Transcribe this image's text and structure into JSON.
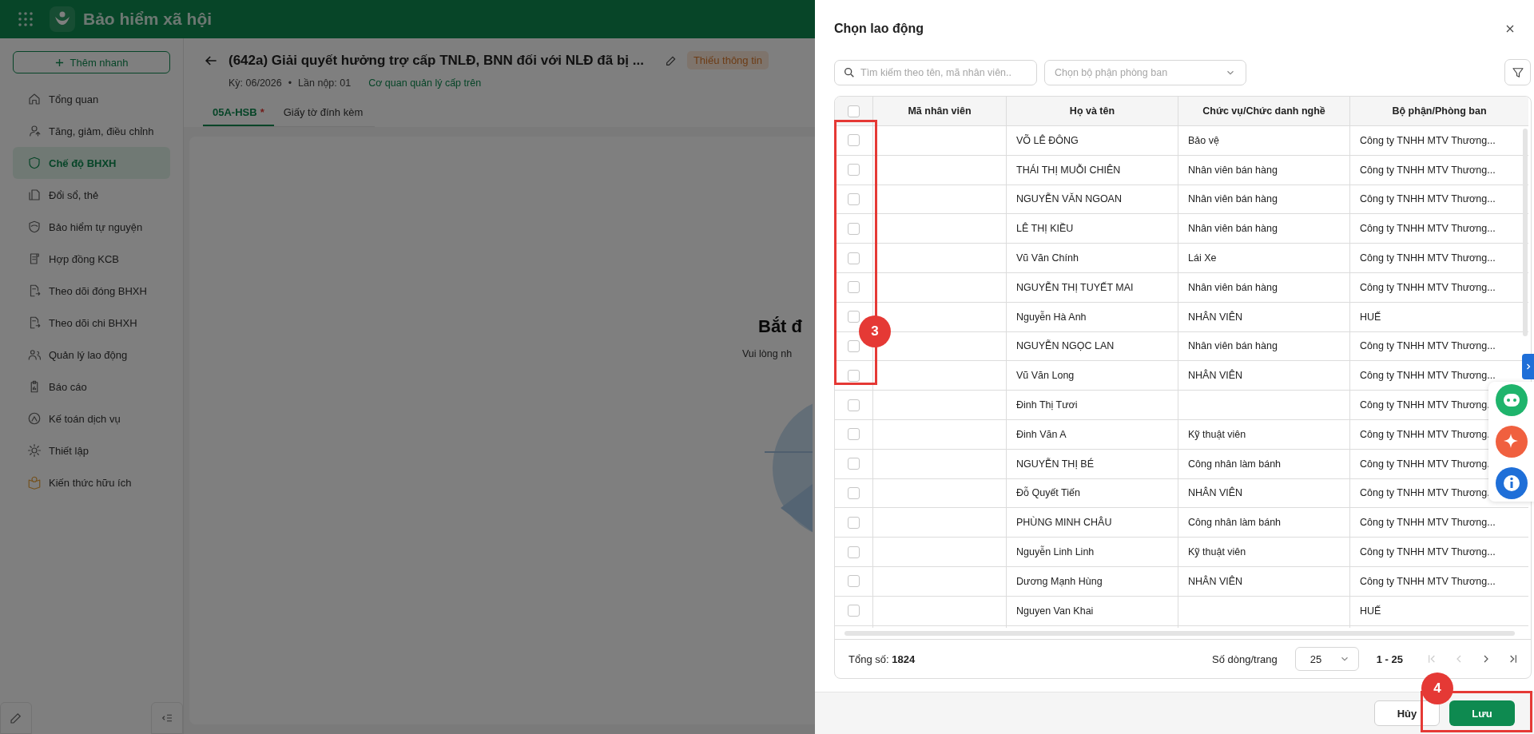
{
  "app_header": {
    "title": "Bảo hiểm xã hội"
  },
  "sidebar": {
    "quick_add": "Thêm nhanh",
    "items": [
      {
        "label": "Tổng quan",
        "selected": false
      },
      {
        "label": "Tăng, giảm, điều chỉnh",
        "selected": false
      },
      {
        "label": "Chế độ BHXH",
        "selected": true
      },
      {
        "label": "Đổi sổ, thẻ",
        "selected": false
      },
      {
        "label": "Bảo hiểm tự nguyện",
        "selected": false
      },
      {
        "label": "Hợp đồng KCB",
        "selected": false
      },
      {
        "label": "Theo dõi đóng BHXH",
        "selected": false
      },
      {
        "label": "Theo dõi chi BHXH",
        "selected": false
      },
      {
        "label": "Quản lý lao động",
        "selected": false
      },
      {
        "label": "Báo cáo",
        "selected": false
      },
      {
        "label": "Kế toán dịch vụ",
        "selected": false
      },
      {
        "label": "Thiết lập",
        "selected": false
      },
      {
        "label": "Kiến thức hữu ích",
        "selected": false
      }
    ]
  },
  "page": {
    "title": "(642a) Giải quyết hưởng trợ cấp TNLĐ, BNN đối với NLĐ đã bị ...",
    "badge": "Thiếu thông tin",
    "period": "Kỳ: 06/2026",
    "bullet": "•",
    "submission": "Lần nộp: 01",
    "agency_link": "Cơ quan quản lý cấp trên",
    "tabs": [
      {
        "label": "05A-HSB",
        "marker": "*",
        "selected": true
      },
      {
        "label": "Giấy tờ đính kèm",
        "selected": false
      }
    ],
    "empty_state": {
      "title": "Bắt đ",
      "text": "Vui lòng nh"
    }
  },
  "drawer": {
    "title": "Chọn lao động",
    "search": {
      "placeholder": "Tìm kiếm theo tên, mã nhân viên.."
    },
    "department_select": {
      "placeholder": "Chọn bộ phận phòng ban"
    },
    "table": {
      "all_checked": false,
      "columns": [
        "Mã nhân viên",
        "Họ và tên",
        "Chức vụ/Chức danh nghề",
        "Bộ phận/Phòng ban"
      ],
      "rows": [
        {
          "checked": false,
          "name": "VÕ LÊ ĐÔNG",
          "position": "Bảo vệ",
          "department": "Công ty TNHH MTV Thương..."
        },
        {
          "checked": false,
          "name": "THÁI THỊ MUỖI CHIÊN",
          "position": "Nhân viên bán hàng",
          "department": "Công ty TNHH MTV Thương..."
        },
        {
          "checked": false,
          "name": "NGUYỄN VĂN NGOAN",
          "position": "Nhân viên bán hàng",
          "department": "Công ty TNHH MTV Thương..."
        },
        {
          "checked": false,
          "name": "LÊ THỊ KIỀU",
          "position": "Nhân viên bán hàng",
          "department": "Công ty TNHH MTV Thương..."
        },
        {
          "checked": false,
          "name": "Vũ Văn Chính",
          "position": "Lái Xe",
          "department": "Công ty TNHH MTV Thương..."
        },
        {
          "checked": false,
          "name": "NGUYỄN THỊ TUYẾT MAI",
          "position": "Nhân viên bán hàng",
          "department": "Công ty TNHH MTV Thương..."
        },
        {
          "checked": false,
          "name": "Nguyễn Hà Anh",
          "position": "NHÂN VIÊN",
          "department": "HUẾ"
        },
        {
          "checked": false,
          "name": "NGUYỄN NGỌC LAN",
          "position": "Nhân viên bán hàng",
          "department": "Công ty TNHH MTV Thương..."
        },
        {
          "checked": false,
          "name": "Vũ Văn Long",
          "position": "NHÂN VIÊN",
          "department": "Công ty TNHH MTV Thương..."
        },
        {
          "checked": false,
          "name": "Đinh Thị Tươi",
          "position": "",
          "department": "Công ty TNHH MTV Thương."
        },
        {
          "checked": false,
          "name": "Đinh Văn A",
          "position": "Kỹ thuật viên",
          "department": "Công ty TNHH MTV Thương."
        },
        {
          "checked": false,
          "name": "NGUYỄN THỊ BÉ",
          "position": "Công nhân làm bánh",
          "department": "Công ty TNHH MTV Thương."
        },
        {
          "checked": false,
          "name": "Đỗ Quyết Tiến",
          "position": "NHÂN VIÊN",
          "department": "Công ty TNHH MTV Thương."
        },
        {
          "checked": false,
          "name": "PHÙNG MINH CHÂU",
          "position": "Công nhân làm bánh",
          "department": "Công ty TNHH MTV Thương..."
        },
        {
          "checked": false,
          "name": "Nguyễn Linh Linh",
          "position": "Kỹ thuật viên",
          "department": "Công ty TNHH MTV Thương..."
        },
        {
          "checked": false,
          "name": "Dương Mạnh Hùng",
          "position": "NHÂN VIÊN",
          "department": "Công ty TNHH MTV Thương..."
        },
        {
          "checked": false,
          "name": "Nguyen Van Khai",
          "position": "",
          "department": "HUẾ"
        }
      ]
    },
    "footer": {
      "total": "Tổng số: **1824**",
      "page_size_label": "Số dòng/trang",
      "page_size": "25",
      "range": "1 - 25",
      "pager": [
        {
          "kind": "first",
          "disabled": true
        },
        {
          "kind": "prev",
          "disabled": true
        },
        {
          "kind": "next",
          "disabled": false
        },
        {
          "kind": "last",
          "disabled": false
        }
      ]
    },
    "buttons": [
      {
        "kind": "cancel",
        "label": "Hủy"
      },
      {
        "kind": "save",
        "label": "Lưu"
      }
    ]
  },
  "annotations": [
    {
      "number": "3"
    },
    {
      "number": "4"
    }
  ]
}
